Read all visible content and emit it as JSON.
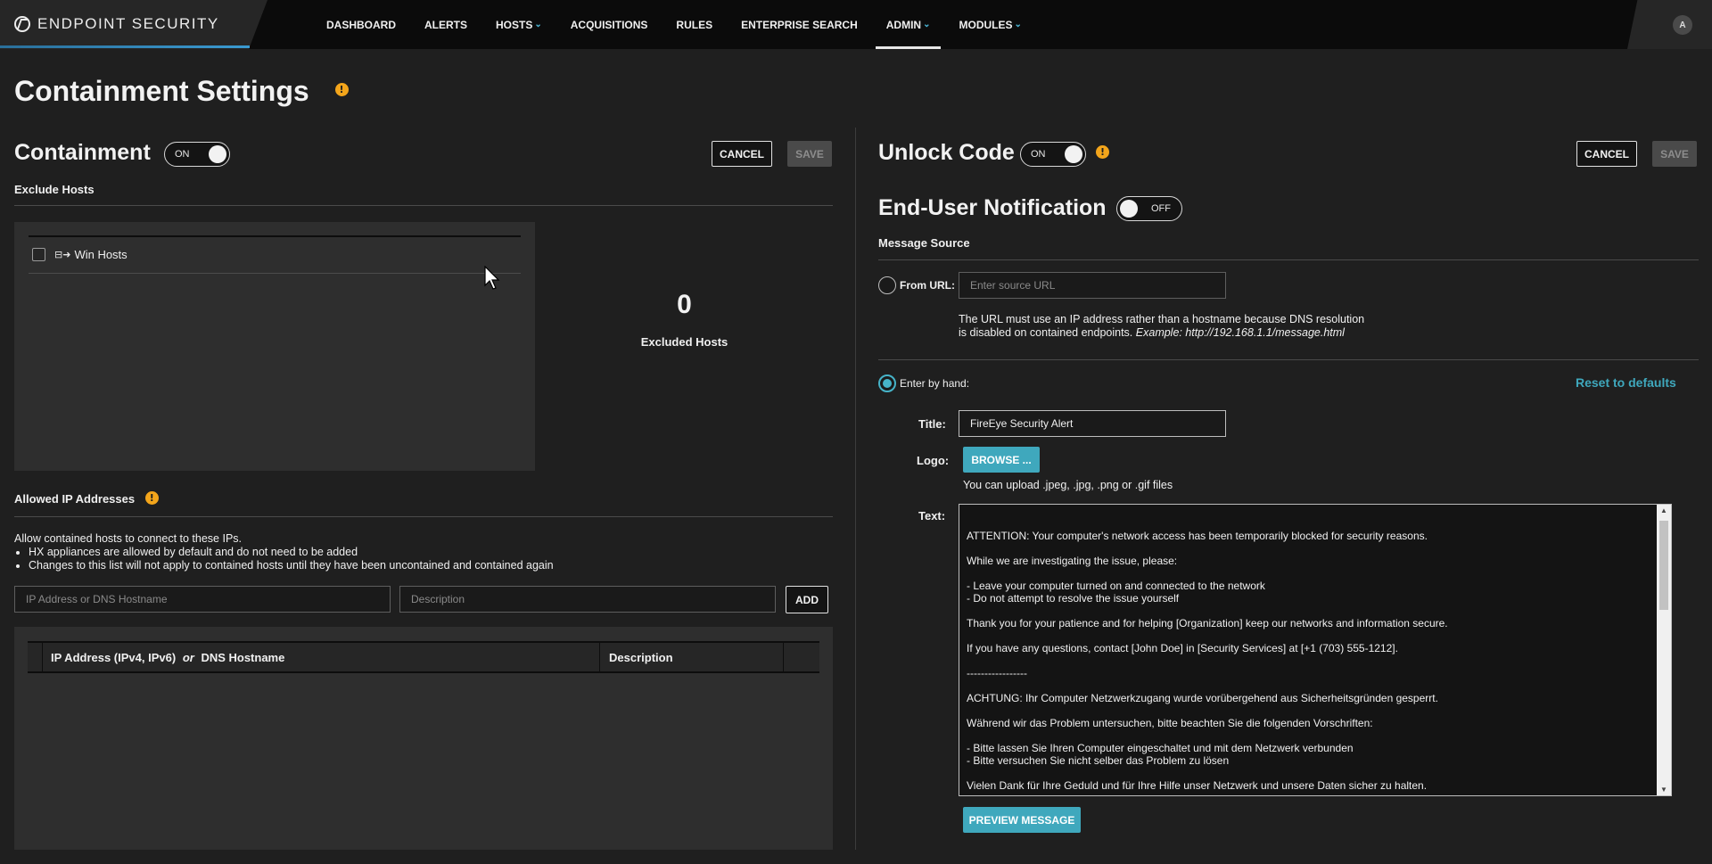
{
  "nav": {
    "brand": "ENDPOINT SECURITY",
    "items": [
      {
        "label": "DASHBOARD",
        "dropdown": false,
        "active": false
      },
      {
        "label": "ALERTS",
        "dropdown": false,
        "active": false
      },
      {
        "label": "HOSTS",
        "dropdown": true,
        "active": false
      },
      {
        "label": "ACQUISITIONS",
        "dropdown": false,
        "active": false
      },
      {
        "label": "RULES",
        "dropdown": false,
        "active": false
      },
      {
        "label": "ENTERPRISE SEARCH",
        "dropdown": false,
        "active": false
      },
      {
        "label": "ADMIN",
        "dropdown": true,
        "active": true
      },
      {
        "label": "MODULES",
        "dropdown": true,
        "active": false
      }
    ],
    "avatar": "A"
  },
  "page": {
    "title": "Containment Settings",
    "warning_icon": "exclamation-icon"
  },
  "containment": {
    "title": "Containment",
    "toggle": "ON",
    "cancel": "CANCEL",
    "save": "SAVE",
    "exclude_hosts_label": "Exclude Hosts",
    "host_list": [
      {
        "name": "Win Hosts",
        "icon": "host-group-icon",
        "checked": false
      }
    ],
    "excluded_count": "0",
    "excluded_label": "Excluded Hosts"
  },
  "allowed_ips": {
    "title": "Allowed IP Addresses",
    "intro": "Allow contained hosts to connect to these IPs.",
    "bullets": [
      "HX appliances are allowed by default and do not need to be added",
      "Changes to this list will not apply to contained hosts until they have been uncontained and contained again"
    ],
    "ip_placeholder": "IP Address or DNS Hostname",
    "desc_placeholder": "Description",
    "add": "ADD",
    "col_ip_a": "IP Address (IPv4, IPv6)",
    "col_ip_or": "or",
    "col_ip_b": "DNS Hostname",
    "col_desc": "Description"
  },
  "unlock": {
    "title": "Unlock Code",
    "toggle": "ON",
    "cancel": "CANCEL",
    "save": "SAVE"
  },
  "notification": {
    "title": "End-User Notification",
    "toggle": "OFF",
    "message_source": "Message Source",
    "from_url_label": "From URL:",
    "url_placeholder": "Enter source URL",
    "url_note_1": "The URL must use an IP address rather than a hostname because DNS resolution",
    "url_note_2": "is disabled on contained endpoints.",
    "url_note_example": "Example: http://192.168.1.1/message.html",
    "by_hand_label": "Enter by hand:",
    "reset": "Reset to defaults",
    "title_label": "Title:",
    "title_value": "FireEye Security Alert",
    "logo_label": "Logo:",
    "browse": "BROWSE ...",
    "upload_note": "You can upload .jpeg, .jpg, .png or .gif files",
    "text_label": "Text:",
    "text_lines": [
      "ATTENTION: Your computer's network access has been temporarily blocked for security reasons.",
      "While we are investigating the issue, please:",
      "- Leave your computer turned on and connected to the network\n- Do not attempt to resolve the issue yourself",
      "Thank you for your patience and for helping [Organization] keep our networks and information secure.",
      "If you have any questions, contact [John Doe] in [Security Services] at [+1 (703) 555-1212].",
      "-----------------",
      "ACHTUNG: Ihr Computer Netzwerkzugang wurde vorübergehend aus Sicherheitsgründen gesperrt.",
      "Während wir das Problem untersuchen, bitte beachten Sie die folgenden Vorschriften:",
      "- Bitte lassen Sie Ihren Computer eingeschaltet und mit dem Netzwerk verbunden\n- Bitte versuchen Sie nicht selber das Problem zu lösen",
      "Vielen Dank für Ihre Geduld und für Ihre Hilfe unser Netzwerk und unsere Daten sicher zu halten."
    ],
    "preview": "PREVIEW MESSAGE"
  },
  "colors": {
    "accent_teal": "#3fa8bd",
    "warning": "#f3a51b",
    "background": "#1f1f1f"
  }
}
